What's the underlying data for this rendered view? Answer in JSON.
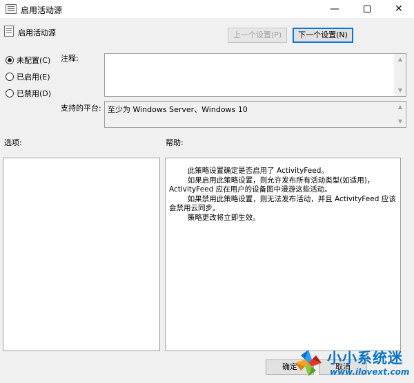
{
  "window": {
    "title": "启用活动源",
    "minimize_glyph": "—",
    "close_glyph": "✕"
  },
  "header": {
    "policy_title": "启用活动源",
    "prev_button": "上一个设置(P)",
    "next_button": "下一个设置(N)"
  },
  "state": {
    "options": [
      {
        "label": "未配置(C)",
        "checked": true
      },
      {
        "label": "已启用(E)",
        "checked": false
      },
      {
        "label": "已禁用(D)",
        "checked": false
      }
    ]
  },
  "fields": {
    "comment_label": "注释:",
    "comment_value": "",
    "platform_label": "支持的平台:",
    "platform_value": "至少为 Windows Server、Windows 10"
  },
  "sections": {
    "options_label": "选项:",
    "help_label": "帮助:"
  },
  "help": {
    "lines": [
      "        此策略设置确定是否启用了 ActivityFeed。",
      "        如果启用此策略设置，则允许发布所有活动类型(如适用)，ActivityFeed 应在用户的设备图中漫游这些活动。",
      "        如果禁用此策略设置，则无法发布活动，并且 ActivityFeed 应该会禁用云同步。",
      "        策略更改将立即生效。"
    ]
  },
  "footer": {
    "ok_button": "确定",
    "cancel_button": "取消"
  },
  "watermark": {
    "brand": "小小系统迷",
    "url": "www.ilovext.com"
  },
  "colors": {
    "focus_border": "#0078d7",
    "watermark_blue": "#0a74c4"
  },
  "icons": {
    "app": "policy-document-icon",
    "scroll_up": "scroll-up-arrow-icon",
    "scroll_down": "scroll-down-arrow-icon"
  }
}
